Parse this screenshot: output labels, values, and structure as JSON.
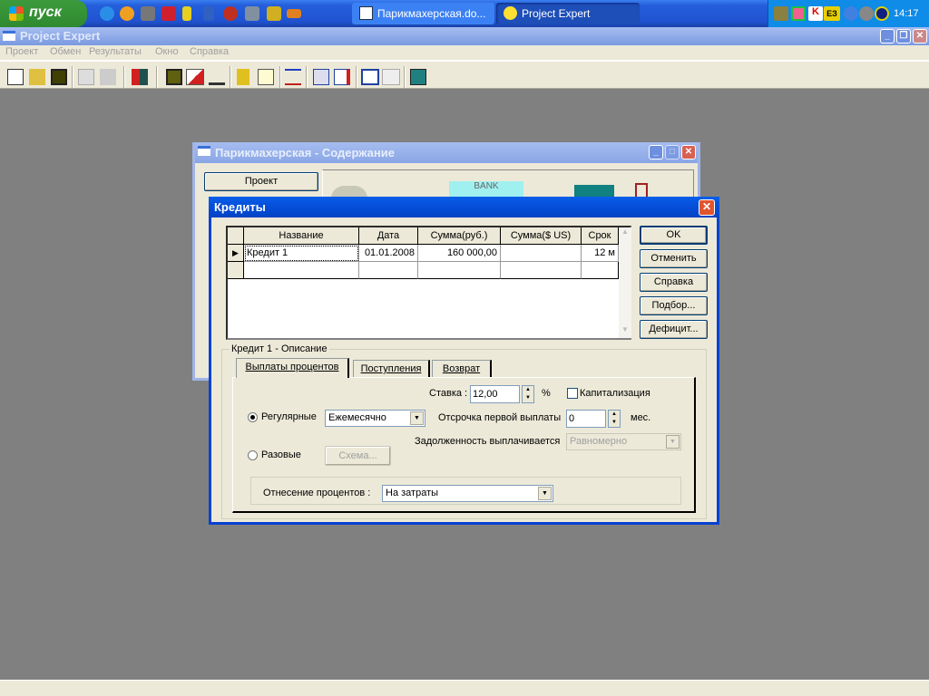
{
  "taskbar": {
    "start_label": "пуск",
    "tasks": [
      {
        "label": "Парикмахерская.do..."
      },
      {
        "label": "Project Expert"
      }
    ],
    "clock": "14:17"
  },
  "app": {
    "title": "Project Expert",
    "menu": [
      "Проект",
      "Обмен",
      "Результаты",
      "Окно",
      "Справка"
    ]
  },
  "bg_window": {
    "title": "Парикмахерская - Содержание",
    "tab_project": "Проект",
    "bank_label": "BANK"
  },
  "dialog": {
    "title": "Кредиты",
    "table": {
      "columns": [
        "Название",
        "Дата",
        "Сумма(руб.)",
        "Сумма($ US)",
        "Срок"
      ],
      "rows": [
        [
          "Кредит 1",
          "01.01.2008",
          "160 000,00",
          "",
          "12 м"
        ],
        [
          "",
          "",
          "",
          "",
          ""
        ]
      ]
    },
    "buttons": {
      "ok": "OK",
      "cancel": "Отменить",
      "help": "Справка",
      "select": "Подбор...",
      "deficit": "Дефицит..."
    },
    "group_title": "Кредит 1 - Описание",
    "tabs": [
      "Выплаты процентов",
      "Поступления",
      "Возврат"
    ],
    "rate_label": "Ставка :",
    "rate_value": "12,00",
    "percent": "%",
    "capitalization_label": "Капитализация",
    "capitalization_checked": false,
    "regular_label": "Регулярные",
    "regular_selected": true,
    "frequency_value": "Ежемесячно",
    "delay_label": "Отсрочка первой выплаты",
    "delay_value": "0",
    "delay_unit": "мес.",
    "debt_label": "Задолженность выплачивается",
    "debt_value": "Равномерно",
    "onetime_label": "Разовые",
    "scheme_button": "Схема...",
    "allocation_label": "Отнесение процентов :",
    "allocation_value": "На затраты"
  }
}
